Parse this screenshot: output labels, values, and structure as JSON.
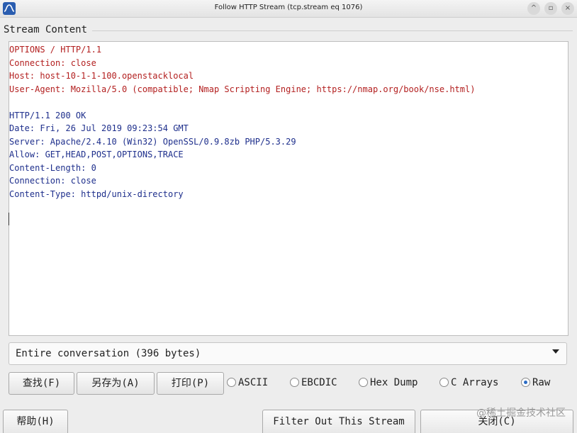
{
  "window": {
    "title": "Follow HTTP Stream (tcp.stream eq 1076)",
    "controls": [
      "^",
      "▫",
      "×"
    ]
  },
  "group_label": "Stream Content",
  "stream": {
    "client_lines": [
      "OPTIONS / HTTP/1.1",
      "Connection: close",
      "Host: host-10-1-1-100.openstacklocal",
      "User-Agent: Mozilla/5.0 (compatible; Nmap Scripting Engine; https://nmap.org/book/nse.html)"
    ],
    "server_lines": [
      "HTTP/1.1 200 OK",
      "Date: Fri, 26 Jul 2019 09:23:54 GMT",
      "Server: Apache/2.4.10 (Win32) OpenSSL/0.9.8zb PHP/5.3.29",
      "Allow: GET,HEAD,POST,OPTIONS,TRACE",
      "Content-Length: 0",
      "Connection: close",
      "Content-Type: httpd/unix-directory"
    ],
    "colors": {
      "client": "#b32020",
      "server": "#1e2f8c"
    }
  },
  "conversation_select": {
    "value": "Entire conversation (396 bytes)"
  },
  "buttons": {
    "find": "查找(F)",
    "save_as": "另存为(A)",
    "print": "打印(P)"
  },
  "format_options": {
    "ascii": "ASCII",
    "ebcdic": "EBCDIC",
    "hex_dump": "Hex Dump",
    "c_arrays": "C Arrays",
    "raw": "Raw",
    "selected": "Raw"
  },
  "bottom": {
    "help": "帮助(H)",
    "filter_out": "Filter Out This Stream",
    "close": "关闭(C)"
  },
  "watermark": "@稀土掘金技术社区"
}
